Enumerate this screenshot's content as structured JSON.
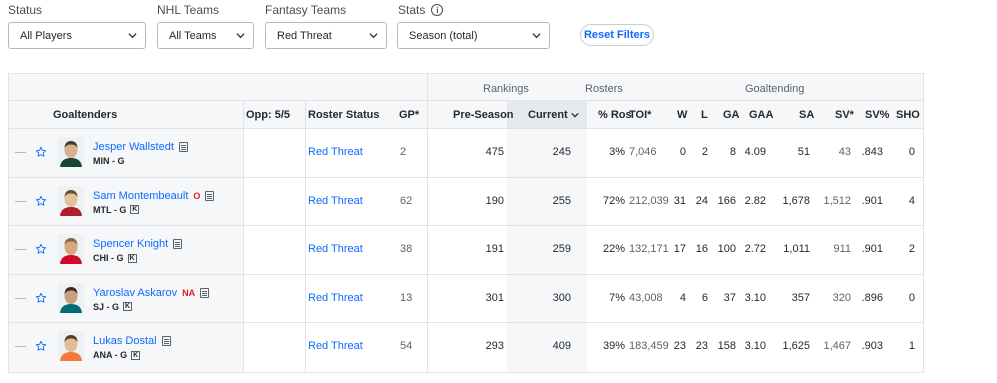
{
  "filters": {
    "status": {
      "label": "Status",
      "value": "All Players"
    },
    "nhl_teams": {
      "label": "NHL Teams",
      "value": "All Teams"
    },
    "fantasy_teams": {
      "label": "Fantasy Teams",
      "value": "Red Threat"
    },
    "stats": {
      "label": "Stats",
      "value": "Season (total)"
    },
    "reset_label": "Reset Filters"
  },
  "table": {
    "groups": {
      "rankings": "Rankings",
      "rosters": "Rosters",
      "goaltending": "Goaltending"
    },
    "columns": {
      "goaltenders": "Goaltenders",
      "opp": "Opp: 5/5",
      "roster_status": "Roster Status",
      "gp": "GP*",
      "pre_season": "Pre-Season",
      "current": "Current",
      "pct_ros": "% Ros",
      "toi": "TOI*",
      "w": "W",
      "l": "L",
      "ga": "GA",
      "gaa": "GAA",
      "sa": "SA",
      "sv": "SV*",
      "sv_pct": "SV%",
      "sho": "SHO"
    },
    "rows": [
      {
        "name": "Jesper Wallstedt",
        "status": "",
        "team_pos": "MIN - G",
        "keeper": false,
        "roster": "Red Threat",
        "gp": "2",
        "pre": "475",
        "cur": "245",
        "ros": "3%",
        "toi": "7,046",
        "w": "0",
        "l": "2",
        "ga": "8",
        "gaa": "4.09",
        "sa": "51",
        "sv": "43",
        "svp": ".843",
        "sho": "0"
      },
      {
        "name": "Sam Montembeault",
        "status": "O",
        "team_pos": "MTL - G",
        "keeper": true,
        "roster": "Red Threat",
        "gp": "62",
        "pre": "190",
        "cur": "255",
        "ros": "72%",
        "toi": "212,039",
        "w": "31",
        "l": "24",
        "ga": "166",
        "gaa": "2.82",
        "sa": "1,678",
        "sv": "1,512",
        "svp": ".901",
        "sho": "4"
      },
      {
        "name": "Spencer Knight",
        "status": "",
        "team_pos": "CHI - G",
        "keeper": true,
        "roster": "Red Threat",
        "gp": "38",
        "pre": "191",
        "cur": "259",
        "ros": "22%",
        "toi": "132,171",
        "w": "17",
        "l": "16",
        "ga": "100",
        "gaa": "2.72",
        "sa": "1,011",
        "sv": "911",
        "svp": ".901",
        "sho": "2"
      },
      {
        "name": "Yaroslav Askarov",
        "status": "NA",
        "team_pos": "SJ - G",
        "keeper": true,
        "roster": "Red Threat",
        "gp": "13",
        "pre": "301",
        "cur": "300",
        "ros": "7%",
        "toi": "43,008",
        "w": "4",
        "l": "6",
        "ga": "37",
        "gaa": "3.10",
        "sa": "357",
        "sv": "320",
        "svp": ".896",
        "sho": "0"
      },
      {
        "name": "Lukas Dostal",
        "status": "",
        "team_pos": "ANA - G",
        "keeper": true,
        "roster": "Red Threat",
        "gp": "54",
        "pre": "293",
        "cur": "409",
        "ros": "39%",
        "toi": "183,459",
        "w": "23",
        "l": "23",
        "ga": "158",
        "gaa": "3.10",
        "sa": "1,625",
        "sv": "1,467",
        "svp": ".903",
        "sho": "1"
      }
    ]
  },
  "icons": {
    "info": "info-icon",
    "chevron": "chevron-down-icon",
    "star": "star-outline-icon",
    "notes": "notes-icon",
    "keeper": "K",
    "sort": "sort-desc-icon"
  },
  "colors": {
    "link": "#0f69ff",
    "status_red": "#e0202b",
    "header_bg": "#f5f7f9",
    "active_col_bg": "#e6e9ec",
    "border": "#e0e4e9"
  }
}
